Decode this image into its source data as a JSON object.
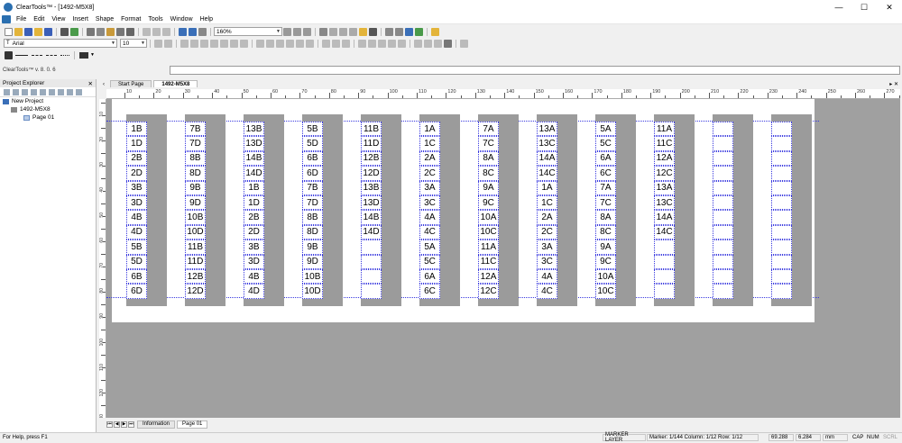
{
  "window": {
    "title": "ClearTools™ - [1492-M5X8]",
    "min": "—",
    "max": "☐",
    "close": "✕"
  },
  "menu": [
    "File",
    "Edit",
    "View",
    "Insert",
    "Shape",
    "Format",
    "Tools",
    "Window",
    "Help"
  ],
  "toolbar": {
    "zoom": "160%",
    "font": "Arial",
    "font_size": "10"
  },
  "version_label": "ClearTools™ v. 8. 0. 6",
  "explorer": {
    "title": "Project Explorer",
    "close": "✕",
    "tree": [
      {
        "label": "New Project",
        "level": 0
      },
      {
        "label": "1492-M5X8",
        "level": 1
      },
      {
        "label": "Page 01",
        "level": 2
      }
    ]
  },
  "doc_tabs": [
    "Start Page",
    "1492-M5X8"
  ],
  "ruler_h": [
    "10",
    "20",
    "30",
    "40",
    "50",
    "60",
    "70",
    "80",
    "90",
    "100",
    "110",
    "120",
    "130",
    "140",
    "150",
    "160",
    "170",
    "180",
    "190",
    "200",
    "210",
    "220",
    "230",
    "240",
    "250",
    "260",
    "270"
  ],
  "ruler_v": [
    "10",
    "20",
    "30",
    "40",
    "50",
    "60",
    "70",
    "80",
    "90",
    "100",
    "110",
    "120",
    "130"
  ],
  "columns": [
    [
      "1B",
      "1D",
      "2B",
      "2D",
      "3B",
      "3D",
      "4B",
      "4D",
      "5B",
      "5D",
      "6B",
      "6D"
    ],
    [
      "7B",
      "7D",
      "8B",
      "8D",
      "9B",
      "9D",
      "10B",
      "10D",
      "11B",
      "11D",
      "12B",
      "12D"
    ],
    [
      "13B",
      "13D",
      "14B",
      "14D",
      "1B",
      "1D",
      "2B",
      "2D",
      "3B",
      "3D",
      "4B",
      "4D"
    ],
    [
      "5B",
      "5D",
      "6B",
      "6D",
      "7B",
      "7D",
      "8B",
      "8D",
      "9B",
      "9D",
      "10B",
      "10D"
    ],
    [
      "11B",
      "11D",
      "12B",
      "12D",
      "13B",
      "13D",
      "14B",
      "14D",
      "",
      "",
      "",
      ""
    ],
    [
      "1A",
      "1C",
      "2A",
      "2C",
      "3A",
      "3C",
      "4A",
      "4C",
      "5A",
      "5C",
      "6A",
      "6C"
    ],
    [
      "7A",
      "7C",
      "8A",
      "8C",
      "9A",
      "9C",
      "10A",
      "10C",
      "11A",
      "11C",
      "12A",
      "12C"
    ],
    [
      "13A",
      "13C",
      "14A",
      "14C",
      "1A",
      "1C",
      "2A",
      "2C",
      "3A",
      "3C",
      "4A",
      "4C"
    ],
    [
      "5A",
      "5C",
      "6A",
      "6C",
      "7A",
      "7C",
      "8A",
      "8C",
      "9A",
      "9C",
      "10A",
      "10C"
    ],
    [
      "11A",
      "11C",
      "12A",
      "12C",
      "13A",
      "13C",
      "14A",
      "14C",
      "",
      "",
      "",
      ""
    ],
    [
      "",
      "",
      "",
      "",
      "",
      "",
      "",
      "",
      "",
      "",
      "",
      ""
    ],
    [
      "",
      "",
      "",
      "",
      "",
      "",
      "",
      "",
      "",
      "",
      "",
      ""
    ]
  ],
  "bottom_tabs": [
    "Information",
    "Page 01"
  ],
  "status": {
    "help": "For Help, press F1",
    "layer": "MARKER LAYER",
    "marker": "Marker: 1/144 Column: 1/12 Row: 1/12",
    "x": "69.288",
    "y": "6.284",
    "unit": "mm",
    "cap": "CAP",
    "num": "NUM",
    "scrl": "SCRL"
  }
}
